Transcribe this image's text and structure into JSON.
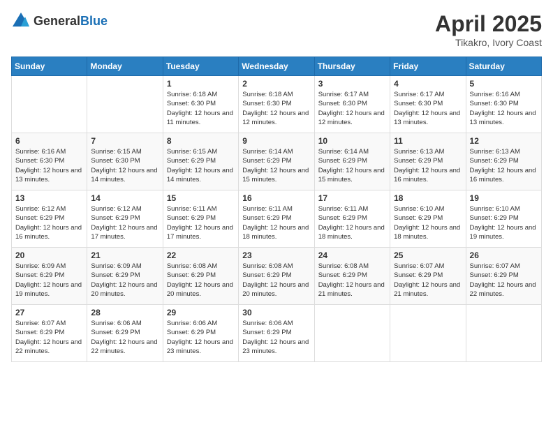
{
  "header": {
    "logo_general": "General",
    "logo_blue": "Blue",
    "month_year": "April 2025",
    "location": "Tikakro, Ivory Coast"
  },
  "columns": [
    "Sunday",
    "Monday",
    "Tuesday",
    "Wednesday",
    "Thursday",
    "Friday",
    "Saturday"
  ],
  "weeks": [
    [
      {
        "day": "",
        "info": ""
      },
      {
        "day": "",
        "info": ""
      },
      {
        "day": "1",
        "info": "Sunrise: 6:18 AM\nSunset: 6:30 PM\nDaylight: 12 hours and 11 minutes."
      },
      {
        "day": "2",
        "info": "Sunrise: 6:18 AM\nSunset: 6:30 PM\nDaylight: 12 hours and 12 minutes."
      },
      {
        "day": "3",
        "info": "Sunrise: 6:17 AM\nSunset: 6:30 PM\nDaylight: 12 hours and 12 minutes."
      },
      {
        "day": "4",
        "info": "Sunrise: 6:17 AM\nSunset: 6:30 PM\nDaylight: 12 hours and 13 minutes."
      },
      {
        "day": "5",
        "info": "Sunrise: 6:16 AM\nSunset: 6:30 PM\nDaylight: 12 hours and 13 minutes."
      }
    ],
    [
      {
        "day": "6",
        "info": "Sunrise: 6:16 AM\nSunset: 6:30 PM\nDaylight: 12 hours and 13 minutes."
      },
      {
        "day": "7",
        "info": "Sunrise: 6:15 AM\nSunset: 6:30 PM\nDaylight: 12 hours and 14 minutes."
      },
      {
        "day": "8",
        "info": "Sunrise: 6:15 AM\nSunset: 6:29 PM\nDaylight: 12 hours and 14 minutes."
      },
      {
        "day": "9",
        "info": "Sunrise: 6:14 AM\nSunset: 6:29 PM\nDaylight: 12 hours and 15 minutes."
      },
      {
        "day": "10",
        "info": "Sunrise: 6:14 AM\nSunset: 6:29 PM\nDaylight: 12 hours and 15 minutes."
      },
      {
        "day": "11",
        "info": "Sunrise: 6:13 AM\nSunset: 6:29 PM\nDaylight: 12 hours and 16 minutes."
      },
      {
        "day": "12",
        "info": "Sunrise: 6:13 AM\nSunset: 6:29 PM\nDaylight: 12 hours and 16 minutes."
      }
    ],
    [
      {
        "day": "13",
        "info": "Sunrise: 6:12 AM\nSunset: 6:29 PM\nDaylight: 12 hours and 16 minutes."
      },
      {
        "day": "14",
        "info": "Sunrise: 6:12 AM\nSunset: 6:29 PM\nDaylight: 12 hours and 17 minutes."
      },
      {
        "day": "15",
        "info": "Sunrise: 6:11 AM\nSunset: 6:29 PM\nDaylight: 12 hours and 17 minutes."
      },
      {
        "day": "16",
        "info": "Sunrise: 6:11 AM\nSunset: 6:29 PM\nDaylight: 12 hours and 18 minutes."
      },
      {
        "day": "17",
        "info": "Sunrise: 6:11 AM\nSunset: 6:29 PM\nDaylight: 12 hours and 18 minutes."
      },
      {
        "day": "18",
        "info": "Sunrise: 6:10 AM\nSunset: 6:29 PM\nDaylight: 12 hours and 18 minutes."
      },
      {
        "day": "19",
        "info": "Sunrise: 6:10 AM\nSunset: 6:29 PM\nDaylight: 12 hours and 19 minutes."
      }
    ],
    [
      {
        "day": "20",
        "info": "Sunrise: 6:09 AM\nSunset: 6:29 PM\nDaylight: 12 hours and 19 minutes."
      },
      {
        "day": "21",
        "info": "Sunrise: 6:09 AM\nSunset: 6:29 PM\nDaylight: 12 hours and 20 minutes."
      },
      {
        "day": "22",
        "info": "Sunrise: 6:08 AM\nSunset: 6:29 PM\nDaylight: 12 hours and 20 minutes."
      },
      {
        "day": "23",
        "info": "Sunrise: 6:08 AM\nSunset: 6:29 PM\nDaylight: 12 hours and 20 minutes."
      },
      {
        "day": "24",
        "info": "Sunrise: 6:08 AM\nSunset: 6:29 PM\nDaylight: 12 hours and 21 minutes."
      },
      {
        "day": "25",
        "info": "Sunrise: 6:07 AM\nSunset: 6:29 PM\nDaylight: 12 hours and 21 minutes."
      },
      {
        "day": "26",
        "info": "Sunrise: 6:07 AM\nSunset: 6:29 PM\nDaylight: 12 hours and 22 minutes."
      }
    ],
    [
      {
        "day": "27",
        "info": "Sunrise: 6:07 AM\nSunset: 6:29 PM\nDaylight: 12 hours and 22 minutes."
      },
      {
        "day": "28",
        "info": "Sunrise: 6:06 AM\nSunset: 6:29 PM\nDaylight: 12 hours and 22 minutes."
      },
      {
        "day": "29",
        "info": "Sunrise: 6:06 AM\nSunset: 6:29 PM\nDaylight: 12 hours and 23 minutes."
      },
      {
        "day": "30",
        "info": "Sunrise: 6:06 AM\nSunset: 6:29 PM\nDaylight: 12 hours and 23 minutes."
      },
      {
        "day": "",
        "info": ""
      },
      {
        "day": "",
        "info": ""
      },
      {
        "day": "",
        "info": ""
      }
    ]
  ]
}
